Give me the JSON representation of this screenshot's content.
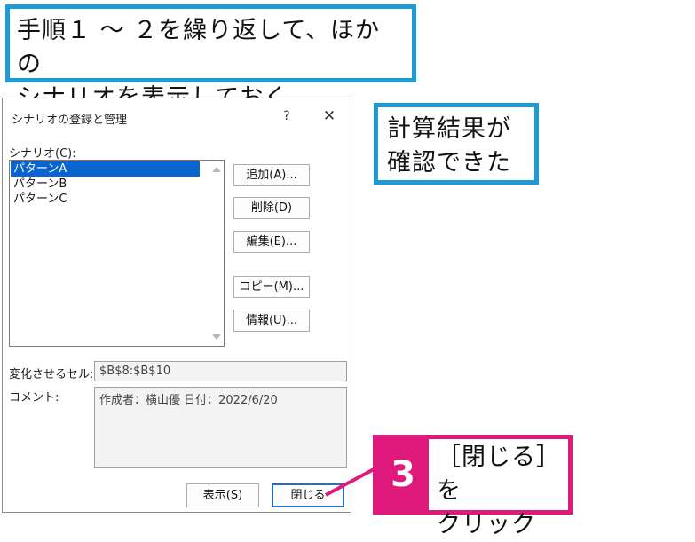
{
  "callouts": {
    "top": [
      "手順１ ～ ２を繰り返して、ほかの",
      "シナリオを表示しておく"
    ],
    "right": [
      "計算結果が",
      "確認できた"
    ],
    "step": {
      "number": "3",
      "lines": [
        "［閉じる］を",
        "クリック"
      ]
    }
  },
  "dialog": {
    "title": "シナリオの登録と管理",
    "help_label": "?",
    "close_label": "✕",
    "scenario_label": "シナリオ(C):",
    "scenarios": [
      "パターンA",
      "パターンB",
      "パターンC"
    ],
    "selected_index": 0,
    "buttons": {
      "add": "追加(A)...",
      "delete": "削除(D)",
      "edit": "編集(E)...",
      "copy": "コピー(M)...",
      "info": "情報(U)..."
    },
    "changing_cells_label": "変化させるセル:",
    "changing_cells_value": "$B$8:$B$10",
    "comment_label": "コメント:",
    "comment_value": "作成者：横山優 日付：2022/6/20",
    "show_button": "表示(S)",
    "close_button": "閉じる"
  },
  "colors": {
    "callout_blue": "#1e9ad6",
    "callout_magenta": "#e0197d",
    "selection": "#0a64d0"
  },
  "icons": {
    "scroll_up": "chevron-up-icon",
    "scroll_down": "chevron-down-icon"
  }
}
